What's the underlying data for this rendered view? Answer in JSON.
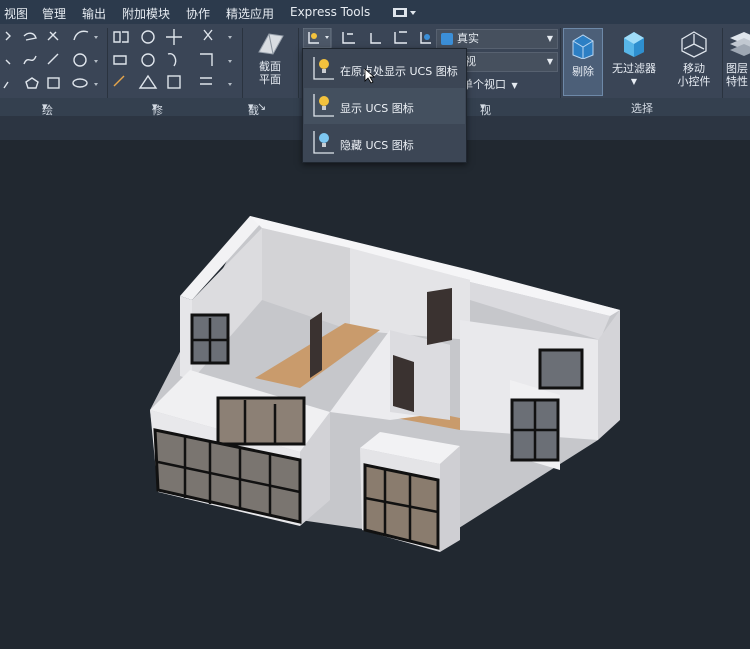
{
  "menu": [
    "视图",
    "管理",
    "输出",
    "附加模块",
    "协作",
    "精选应用",
    "Express Tools"
  ],
  "ribbon": {
    "section_button": [
      "截面",
      "平面"
    ],
    "visual_style": "真实",
    "view_dropdown": "视",
    "viewport_dropdown": "单个视口",
    "cull_button": "剔除",
    "filter_button": "无过滤器",
    "gizmo_button": [
      "移动",
      "小控件"
    ],
    "layer_button": [
      "图层",
      "特性"
    ]
  },
  "panels": {
    "draw": "绘图",
    "modify": "修改",
    "section": "截面",
    "view": "视图",
    "selection": "选择"
  },
  "ucs_menu": {
    "items": [
      "在原点处显示 UCS 图标",
      "显示 UCS 图标",
      "隐藏 UCS 图标"
    ]
  },
  "colors": {
    "ribbon_bg": "#3a4556",
    "menubar_bg": "#2c3a4c",
    "viewport_bg": "#212830",
    "wall": "#e9e9ec",
    "floor": "#c99b6c",
    "accent": "#3b8fd8"
  }
}
